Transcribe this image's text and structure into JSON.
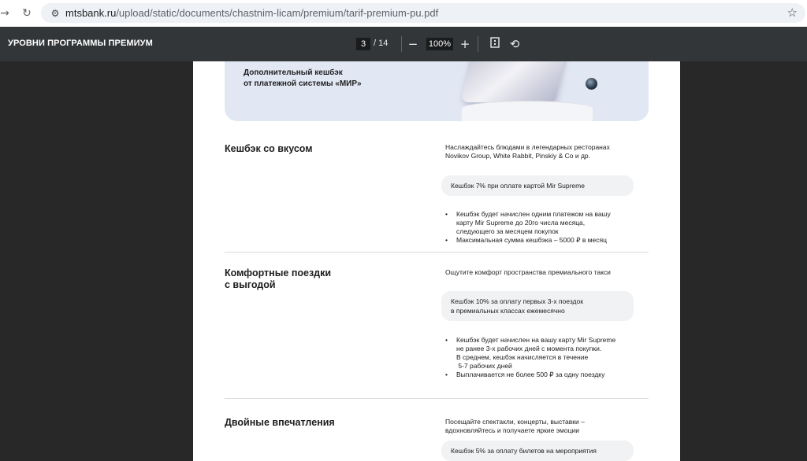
{
  "browser": {
    "url_domain": "mtsbank.ru",
    "url_path": "/upload/static/documents/chastnim-licam/premium/tarif-premium-pu.pdf"
  },
  "toolbar": {
    "title": "УРОВНИ ПРОГРАММЫ ПРЕМИУМ",
    "page_current": "3",
    "page_total": "/ 14",
    "zoom": "100%"
  },
  "banner": {
    "line1": "Дополнительный кешбэк",
    "line2": "от платежной системы «МИР»"
  },
  "sections": [
    {
      "title": "Кешбэк со вкусом",
      "desc": [
        "Наслаждайтесь блюдами в легендарных ресторанах",
        "Novikov Group, White Rabbit, Pinskiy & Co и др."
      ],
      "pill": [
        "Кешбэк  7% при оплате картой Mir Supreme"
      ],
      "bullets": [
        [
          "Кешбэк будет начислен одним платежом на вашу",
          "карту Mir Supreme до 20го числа месяца,",
          "следующего за месяцем покупок"
        ],
        [
          "Максимальная сумма кешбэка – 5000 ₽ в месяц"
        ]
      ]
    },
    {
      "title": [
        "Комфортные поездки",
        "с выгодой"
      ],
      "desc": [
        "Ощутите комфорт пространства премиального такси"
      ],
      "pill": [
        "Кешбэк  10% за оплату первых 3-х поездок",
        "в премиальных классах ежемесячно"
      ],
      "bullets": [
        [
          "Кешбэк будет начислен на вашу карту Mir Supreme",
          "не ранее 3-х рабочих дней с момента покупки.",
          "В среднем, кешбэк начисляется в течение",
          " 5-7 рабочих дней"
        ],
        [
          "Выплачивается не более 500 ₽ за одну поездку"
        ]
      ]
    },
    {
      "title": "Двойные впечатления",
      "desc": [
        "Посещайте спектакли, концерты, выставки –",
        "вдохновляйтесь и получаете яркие эмоции"
      ],
      "pill": [
        "Кешбэк  5% за оплату билетов на мероприятия"
      ]
    }
  ]
}
